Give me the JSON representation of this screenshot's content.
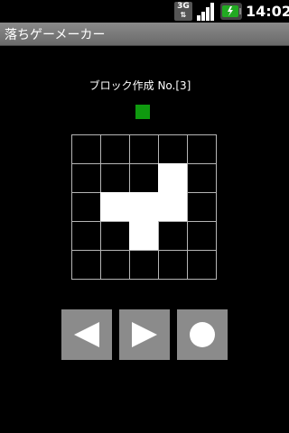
{
  "status_bar": {
    "network_label": "3G",
    "time": "14:02",
    "icons": [
      "3g-data-icon",
      "signal-strength-icon",
      "battery-icon"
    ]
  },
  "app": {
    "title": "落ちゲーメーカー"
  },
  "editor": {
    "block_label": "ブロック作成 No.[3]",
    "block_color": "#0f9a0f",
    "grid": [
      [
        0,
        0,
        0,
        0,
        0
      ],
      [
        0,
        0,
        0,
        1,
        0
      ],
      [
        0,
        1,
        1,
        1,
        0
      ],
      [
        0,
        0,
        1,
        0,
        0
      ],
      [
        0,
        0,
        0,
        0,
        0
      ]
    ]
  },
  "controls": {
    "buttons": [
      {
        "name": "left-arrow-button",
        "icon": "left-arrow-icon"
      },
      {
        "name": "right-arrow-button",
        "icon": "right-arrow-icon"
      },
      {
        "name": "confirm-button",
        "icon": "circle-icon"
      }
    ],
    "button_color": "#8b8b8b"
  }
}
